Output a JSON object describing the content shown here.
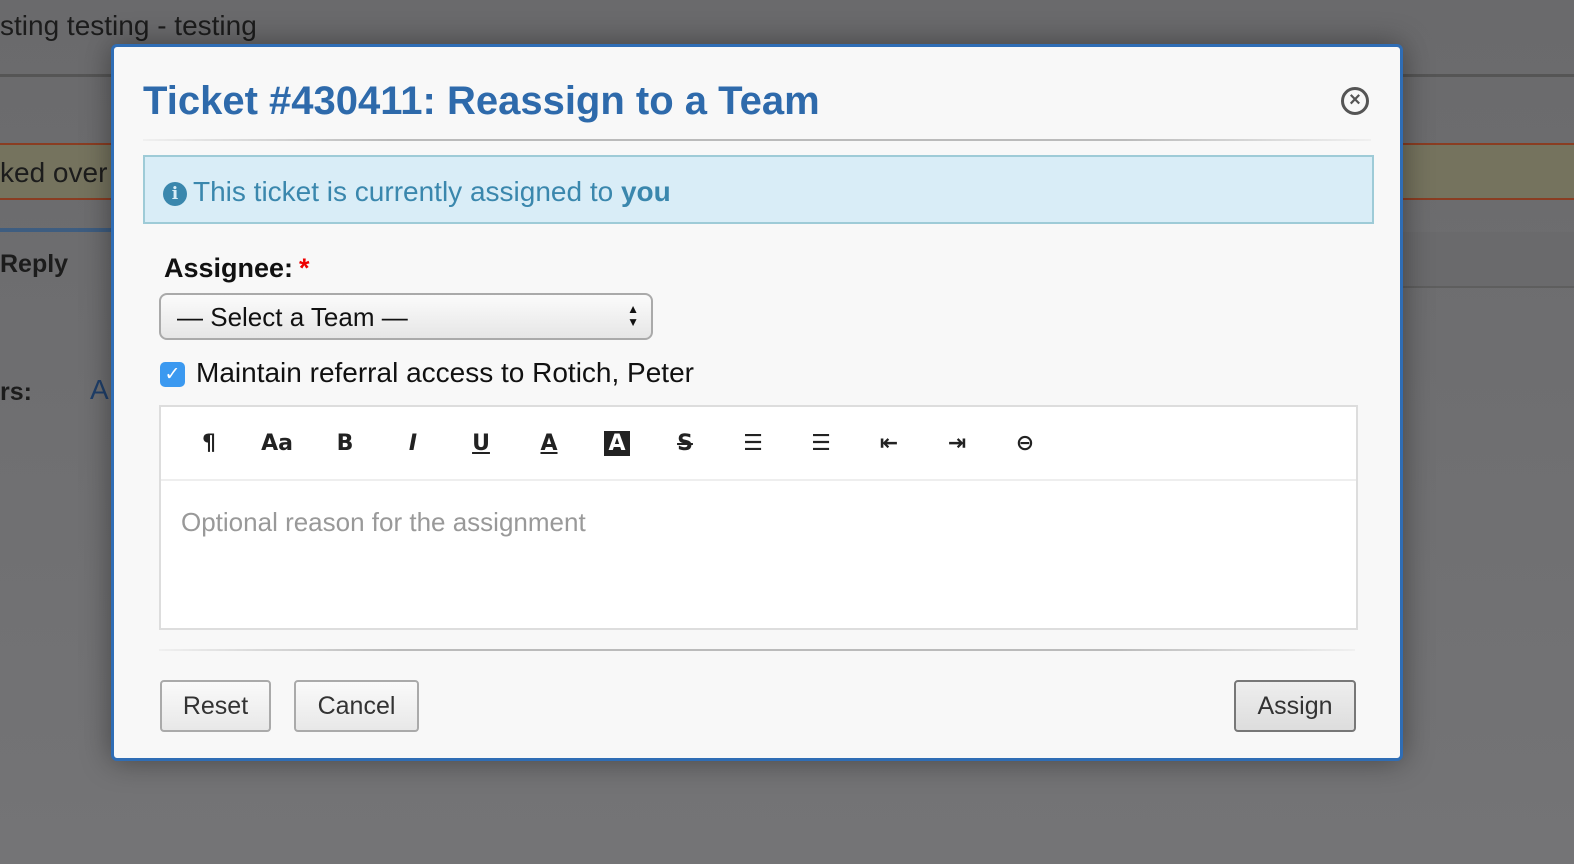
{
  "background": {
    "title": "sting testing - testing",
    "banner": "ked over",
    "reply": "Reply",
    "rs": "rs:",
    "a": "A"
  },
  "modal": {
    "title": "Ticket #430411: Reassign to a Team",
    "close_icon": "close-circle-icon",
    "info": {
      "text": "This ticket is currently assigned to ",
      "bold": "you",
      "icon": "info-circle-icon"
    },
    "assignee_label": "Assignee:",
    "required_mark": "*",
    "select": {
      "value": "— Select a Team —"
    },
    "checkbox": {
      "label": "Maintain referral access to Rotich, Peter",
      "checked": true
    },
    "toolbar": [
      {
        "name": "paragraph",
        "glyph": "¶"
      },
      {
        "name": "font-size",
        "glyph": "Aa"
      },
      {
        "name": "bold",
        "glyph": "B"
      },
      {
        "name": "italic",
        "glyph": "I"
      },
      {
        "name": "underline",
        "glyph": "U"
      },
      {
        "name": "font-color",
        "glyph": "A"
      },
      {
        "name": "background-color",
        "glyph": "A"
      },
      {
        "name": "strikethrough",
        "glyph": "S"
      },
      {
        "name": "unordered-list",
        "glyph": "☰"
      },
      {
        "name": "ordered-list",
        "glyph": "☰"
      },
      {
        "name": "outdent",
        "glyph": "⇤"
      },
      {
        "name": "indent",
        "glyph": "⇥"
      },
      {
        "name": "link",
        "glyph": "⊖"
      }
    ],
    "editor_placeholder": "Optional reason for the assignment",
    "buttons": {
      "reset": "Reset",
      "cancel": "Cancel",
      "assign": "Assign"
    }
  },
  "colors": {
    "accent": "#2e6aab",
    "info_bg": "#d9edf7",
    "checkbox": "#3b99f0"
  }
}
